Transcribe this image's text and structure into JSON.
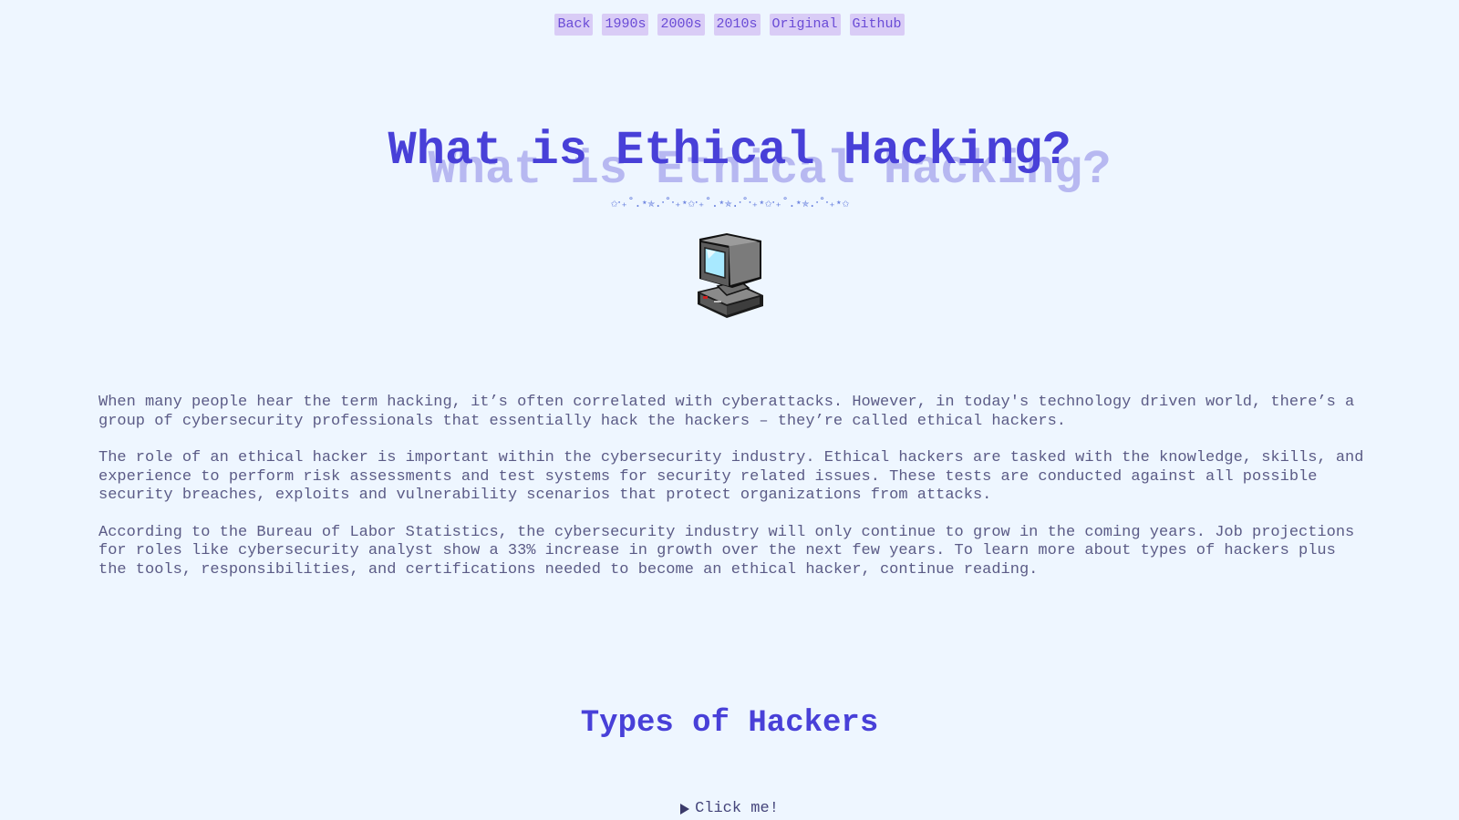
{
  "nav": {
    "items": [
      {
        "label": "Back"
      },
      {
        "label": "1990s"
      },
      {
        "label": "2000s"
      },
      {
        "label": "2010s"
      },
      {
        "label": "Original"
      },
      {
        "label": "Github"
      }
    ]
  },
  "hero": {
    "title": "What is Ethical Hacking?",
    "divider": "✩‧₊˚.⋆✯.‧˚‧₊⋆✩‧₊˚.⋆✯.‧˚‧₊⋆✩‧₊˚.⋆✯.‧˚‧₊⋆✩"
  },
  "icons": {
    "computer": "computer-icon"
  },
  "colors": {
    "background": "#eef6ff",
    "title": "#4840d8",
    "title_shadow": "#b7b8f1",
    "nav_bg": "#d9ccf6",
    "nav_text": "#6a4bd6",
    "body_text": "#5b5b86"
  },
  "intro": {
    "paragraphs": [
      "When many people hear the term hacking, it’s often correlated with cyberattacks. However, in today's technology driven world, there’s a group of cybersecurity professionals that essentially hack the hackers – they’re called ethical hackers.",
      "The role of an ethical hacker is important within the cybersecurity industry. Ethical hackers are tasked with the knowledge, skills, and experience to perform risk assessments and test systems for security related issues. These tests are conducted against all possible security breaches, exploits and vulnerability scenarios that protect organizations from attacks.",
      "According to the Bureau of Labor Statistics, the cybersecurity industry will only continue to grow in the coming years. Job projections for roles like cybersecurity analyst show a 33% increase in growth over the next few years. To learn more about types of hackers plus the tools, responsibilities, and certifications needed to become an ethical hacker, continue reading."
    ]
  },
  "types_section": {
    "title": "Types of Hackers",
    "toggle_label": "Click me!"
  }
}
